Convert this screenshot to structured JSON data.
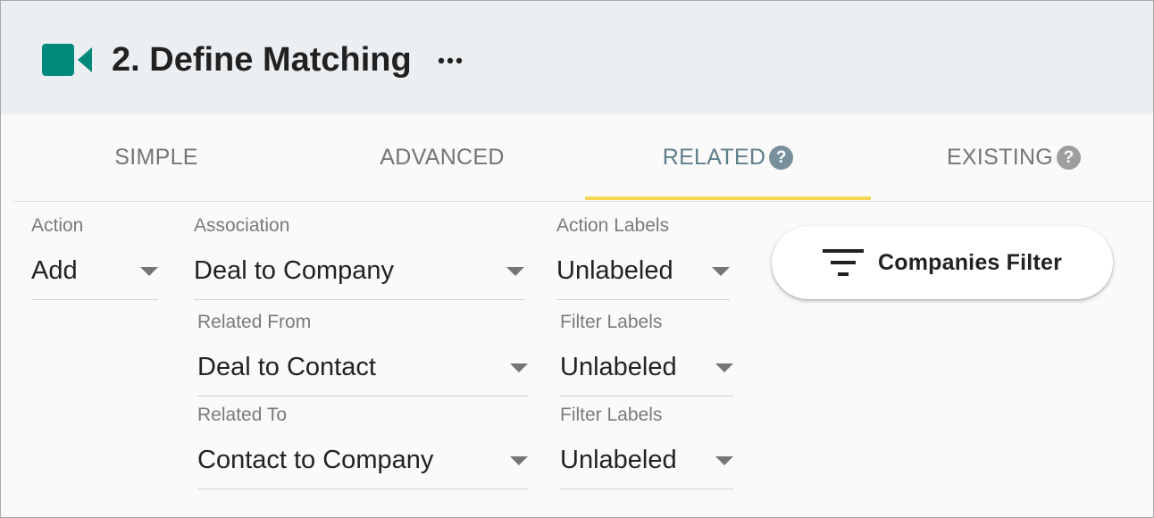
{
  "header": {
    "title": "2. Define Matching",
    "icon": "video-camera-icon",
    "accent": "#00897b",
    "more_icon": "more-horizontal-icon"
  },
  "tabs": [
    {
      "label": "SIMPLE",
      "help": false
    },
    {
      "label": "ADVANCED",
      "help": false
    },
    {
      "label": "RELATED",
      "help": true,
      "active": true
    },
    {
      "label": "EXISTING",
      "help": true
    }
  ],
  "help_glyph": "?",
  "colors": {
    "active_tab_indicator": "#f7d651",
    "active_tab_text": "#607d8b"
  },
  "form": {
    "action": {
      "label": "Action",
      "value": "Add"
    },
    "association": {
      "label": "Association",
      "value": "Deal to Company"
    },
    "action_labels": {
      "label": "Action Labels",
      "value": "Unlabeled"
    },
    "related_from": {
      "label": "Related From",
      "value": "Deal to Contact"
    },
    "filter_labels_1": {
      "label": "Filter Labels",
      "value": "Unlabeled"
    },
    "related_to": {
      "label": "Related To",
      "value": "Contact to Company"
    },
    "filter_labels_2": {
      "label": "Filter Labels",
      "value": "Unlabeled"
    }
  },
  "companies_filter": {
    "label": "Companies Filter",
    "icon": "filter-list-icon"
  }
}
